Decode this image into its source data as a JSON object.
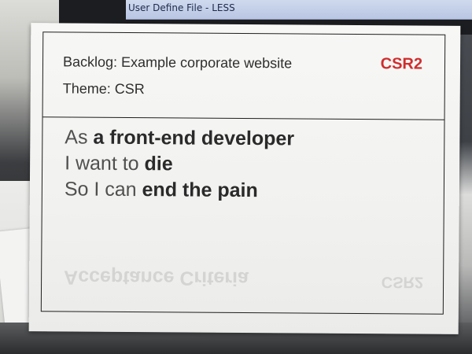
{
  "window": {
    "title": "User Define File - LESS"
  },
  "card": {
    "backlog": "Backlog: Example corporate website",
    "badge": "CSR2",
    "theme": "Theme: CSR",
    "story": {
      "line1_prefix": "As ",
      "line1_bold": "a front-end developer",
      "line2_prefix": "I want to ",
      "line2_bold": "die",
      "line3_prefix": "So I can ",
      "line3_bold": "end the pain"
    },
    "ghost": {
      "left": "Acceptance Criteria",
      "right": "CSR2"
    }
  },
  "colors": {
    "badge": "#cf2e2e",
    "title_bar": "#c4cfe9",
    "card": "#f4f4f2"
  }
}
